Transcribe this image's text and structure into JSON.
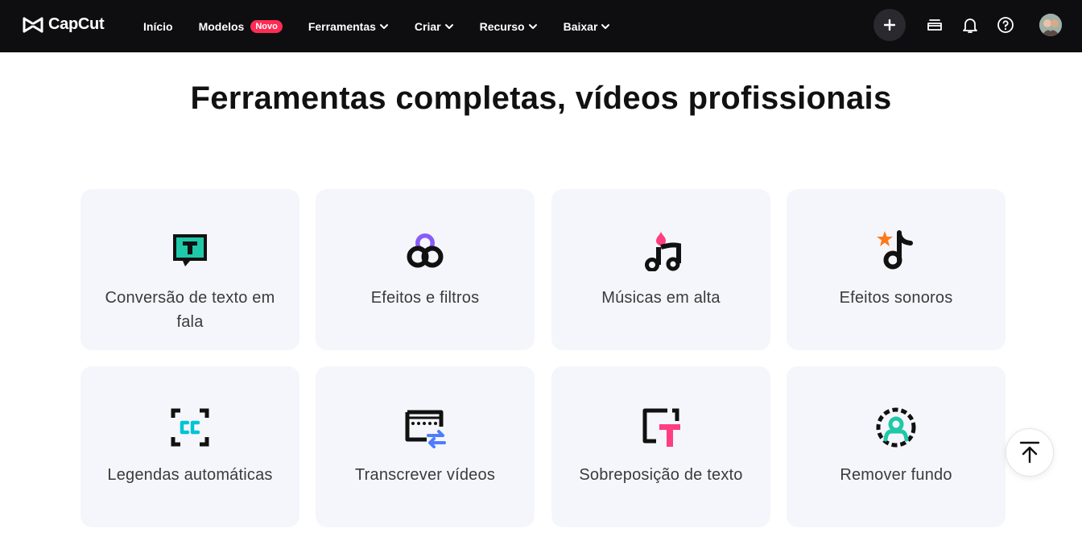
{
  "header": {
    "logo_text": "CapCut",
    "nav": [
      {
        "label": "Início",
        "chevron": false
      },
      {
        "label": "Modelos",
        "chevron": false,
        "badge": "Novo"
      },
      {
        "label": "Ferramentas",
        "chevron": true
      },
      {
        "label": "Criar",
        "chevron": true
      },
      {
        "label": "Recurso",
        "chevron": true
      },
      {
        "label": "Baixar",
        "chevron": true
      }
    ],
    "icons": [
      "plus-icon",
      "layers-icon",
      "bell-icon",
      "help-icon",
      "avatar"
    ]
  },
  "main": {
    "title": "Ferramentas completas, vídeos profissionais",
    "cards": [
      {
        "label": "Conversão de texto em fala",
        "icon": "text-to-speech-icon"
      },
      {
        "label": "Efeitos e filtros",
        "icon": "effects-filters-icon"
      },
      {
        "label": "Músicas em alta",
        "icon": "trending-music-icon"
      },
      {
        "label": "Efeitos sonoros",
        "icon": "sound-effects-icon"
      },
      {
        "label": "Legendas automáticas",
        "icon": "auto-captions-icon"
      },
      {
        "label": "Transcrever vídeos",
        "icon": "transcribe-icon"
      },
      {
        "label": "Sobreposição de texto",
        "icon": "text-overlay-icon"
      },
      {
        "label": "Remover fundo",
        "icon": "remove-background-icon"
      }
    ]
  },
  "colors": {
    "topbar": "#0e0e10",
    "card_bg": "#f4f6fb",
    "badge": "#fe2c55",
    "teal": "#1fc8a8",
    "cyan": "#00c4d4",
    "purple": "#8a5cf6",
    "pink": "#ff3d7f",
    "orange": "#ff7a1a",
    "blue": "#4f7cff"
  },
  "scroll_top_icon": "arrow-up-to-top-icon"
}
